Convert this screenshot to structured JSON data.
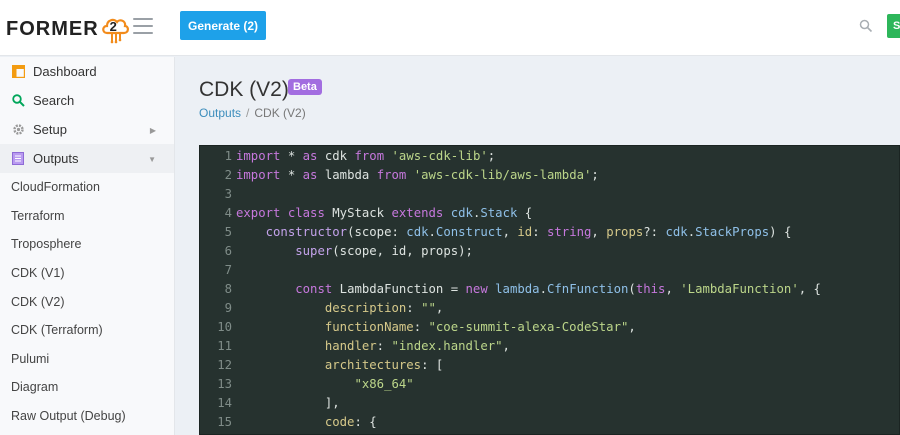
{
  "topbar": {
    "logo_text": "FORMER",
    "logo_number": "2",
    "generate_label": "Generate (2)",
    "green_button_label": "S"
  },
  "sidebar": {
    "items": [
      {
        "label": "Dashboard",
        "icon": "dashboard-icon",
        "color": "#f39c12"
      },
      {
        "label": "Search",
        "icon": "search-icon",
        "color": "#00a65a"
      },
      {
        "label": "Setup",
        "icon": "gear-icon",
        "color": "#999999"
      },
      {
        "label": "Outputs",
        "icon": "list-icon",
        "color": "#8e6bd6"
      }
    ],
    "subitems": [
      "CloudFormation",
      "Terraform",
      "Troposphere",
      "CDK (V1)",
      "CDK (V2)",
      "CDK (Terraform)",
      "Pulumi",
      "Diagram",
      "Raw Output (Debug)"
    ]
  },
  "page": {
    "title": "CDK (V2)",
    "badge": "Beta",
    "breadcrumb": [
      "Outputs",
      "CDK (V2)"
    ]
  },
  "code": {
    "lines": [
      [
        [
          "kw",
          "import"
        ],
        [
          "p",
          " * "
        ],
        [
          "kw",
          "as"
        ],
        [
          "p",
          " cdk "
        ],
        [
          "kw",
          "from"
        ],
        [
          "p",
          " "
        ],
        [
          "str",
          "'aws-cdk-lib'"
        ],
        [
          "p",
          ";"
        ]
      ],
      [
        [
          "kw",
          "import"
        ],
        [
          "p",
          " * "
        ],
        [
          "kw",
          "as"
        ],
        [
          "p",
          " lambda "
        ],
        [
          "kw",
          "from"
        ],
        [
          "p",
          " "
        ],
        [
          "str",
          "'aws-cdk-lib/aws-lambda'"
        ],
        [
          "p",
          ";"
        ]
      ],
      [],
      [
        [
          "kw",
          "export"
        ],
        [
          "p",
          " "
        ],
        [
          "kw",
          "class"
        ],
        [
          "p",
          " MyStack "
        ],
        [
          "kw",
          "extends"
        ],
        [
          "p",
          " "
        ],
        [
          "ty",
          "cdk"
        ],
        [
          "p",
          "."
        ],
        [
          "ty",
          "Stack"
        ],
        [
          "p",
          " {"
        ]
      ],
      [
        [
          "p",
          "    "
        ],
        [
          "fn",
          "constructor"
        ],
        [
          "p",
          "(scope: "
        ],
        [
          "ty",
          "cdk"
        ],
        [
          "p",
          "."
        ],
        [
          "ty",
          "Construct"
        ],
        [
          "p",
          ", "
        ],
        [
          "prop",
          "id"
        ],
        [
          "p",
          ": "
        ],
        [
          "kw",
          "string"
        ],
        [
          "p",
          ", "
        ],
        [
          "prop",
          "props"
        ],
        [
          "p",
          "?: "
        ],
        [
          "ty",
          "cdk"
        ],
        [
          "p",
          "."
        ],
        [
          "ty",
          "StackProps"
        ],
        [
          "p",
          ") {"
        ]
      ],
      [
        [
          "p",
          "        "
        ],
        [
          "fn",
          "super"
        ],
        [
          "p",
          "(scope, id, props);"
        ]
      ],
      [],
      [
        [
          "p",
          "        "
        ],
        [
          "kw",
          "const"
        ],
        [
          "p",
          " LambdaFunction = "
        ],
        [
          "kw",
          "new"
        ],
        [
          "p",
          " "
        ],
        [
          "ty",
          "lambda"
        ],
        [
          "p",
          "."
        ],
        [
          "ty",
          "CfnFunction"
        ],
        [
          "p",
          "("
        ],
        [
          "kw",
          "this"
        ],
        [
          "p",
          ", "
        ],
        [
          "str",
          "'LambdaFunction'"
        ],
        [
          "p",
          ", {"
        ]
      ],
      [
        [
          "p",
          "            "
        ],
        [
          "prop",
          "description"
        ],
        [
          "p",
          ": "
        ],
        [
          "str",
          "\"\""
        ],
        [
          "p",
          ","
        ]
      ],
      [
        [
          "p",
          "            "
        ],
        [
          "prop",
          "functionName"
        ],
        [
          "p",
          ": "
        ],
        [
          "str",
          "\"coe-summit-alexa-CodeStar\""
        ],
        [
          "p",
          ","
        ]
      ],
      [
        [
          "p",
          "            "
        ],
        [
          "prop",
          "handler"
        ],
        [
          "p",
          ": "
        ],
        [
          "str",
          "\"index.handler\""
        ],
        [
          "p",
          ","
        ]
      ],
      [
        [
          "p",
          "            "
        ],
        [
          "prop",
          "architectures"
        ],
        [
          "p",
          ": ["
        ]
      ],
      [
        [
          "p",
          "                "
        ],
        [
          "str",
          "\"x86_64\""
        ]
      ],
      [
        [
          "p",
          "            ],"
        ]
      ],
      [
        [
          "p",
          "            "
        ],
        [
          "prop",
          "code"
        ],
        [
          "p",
          ": {"
        ]
      ]
    ]
  }
}
